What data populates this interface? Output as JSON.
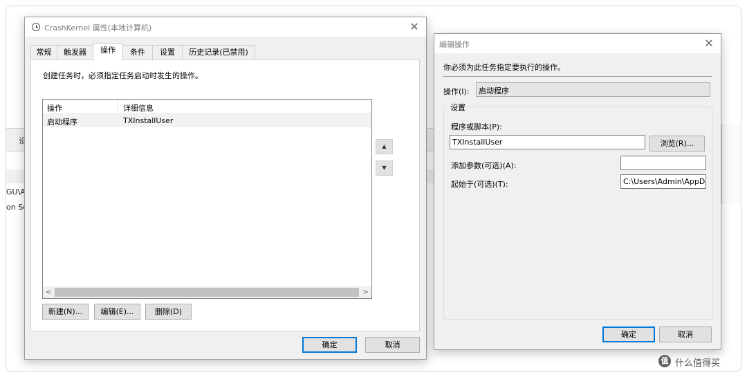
{
  "background": {
    "toolbar_label": "设",
    "text_1": "GU\\Ac",
    "text_2": "on Se"
  },
  "properties_dialog": {
    "title": "CrashKernel 属性(本地计算机)",
    "close_glyph": "✕",
    "tabs": [
      {
        "label": "常规",
        "active": false
      },
      {
        "label": "触发器",
        "active": false
      },
      {
        "label": "操作",
        "active": true
      },
      {
        "label": "条件",
        "active": false
      },
      {
        "label": "设置",
        "active": false
      },
      {
        "label": "历史记录(已禁用)",
        "active": false
      }
    ],
    "description": "创建任务时，必须指定任务启动时发生的操作。",
    "list": {
      "columns": [
        "操作",
        "详细信息"
      ],
      "rows": [
        {
          "action": "启动程序",
          "details": "TXInstallUser"
        }
      ]
    },
    "scroll_left": "<",
    "scroll_right": ">",
    "move_up": "▲",
    "move_down": "▼",
    "new_button": "新建(N)...",
    "edit_button": "编辑(E)...",
    "delete_button": "删除(D)",
    "ok_button": "确定",
    "cancel_button": "取消"
  },
  "edit_dialog": {
    "title": "编辑操作",
    "close_glyph": "✕",
    "instruction": "你必须为此任务指定要执行的操作。",
    "action_label": "操作(I):",
    "action_value": "启动程序",
    "combo_chevron": "⌄",
    "group_label": "设置",
    "program_label": "程序或脚本(P):",
    "program_value": "TXInstallUser",
    "browse_button": "浏览(R)...",
    "args_label": "添加参数(可选)(A):",
    "args_value": "",
    "start_in_label": "起始于(可选)(T):",
    "start_in_value": "C:\\Users\\Admin\\AppD",
    "ok_button": "确定",
    "cancel_button": "取消"
  },
  "watermark": {
    "badge": "值",
    "text": "什么值得买"
  }
}
